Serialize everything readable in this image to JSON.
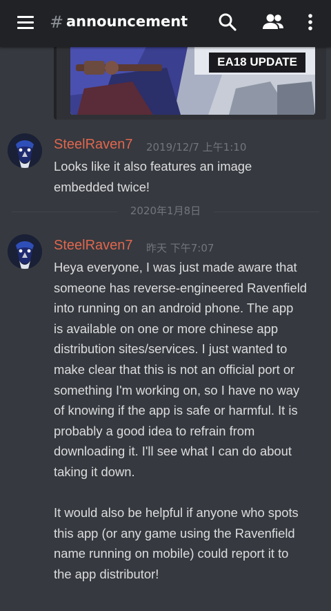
{
  "header": {
    "channel_hash": "#",
    "channel_name": "announcement",
    "icons": [
      "menu-icon",
      "search-icon",
      "members-icon",
      "more-vertical-icon"
    ]
  },
  "embed": {
    "banner_text": "EA18 UPDATE"
  },
  "messages": [
    {
      "author": "SteelRaven7",
      "timestamp": "2019/12/7 上午1:10",
      "text": "Looks like it also features an image\nembedded twice!"
    },
    {
      "author": "SteelRaven7",
      "timestamp": "昨天 下午7:07",
      "text": "Heya everyone, I was just made aware that\nsomeone has reverse-engineered Ravenfield\ninto running on an android phone. The app\nis available on one or more chinese app\ndistribution sites/services. I just wanted to\nmake clear that this is not an official port or\nsomething I'm working on, so I have no way\nof knowing if the app is safe or harmful. It is\nprobably a good idea to refrain from\ndownloading it. I'll see what I can do about\ntaking it down.\n\nIt would also be helpful if anyone who spots\nthis app (or any game using the Ravenfield\nname running on mobile) could report it to\nthe app distributor!"
    }
  ],
  "date_divider": "2020年1月8日",
  "colors": {
    "background": "#36393f",
    "topbar": "#202225",
    "author": "#e0674e",
    "timestamp": "#72767d",
    "text": "#dcddde"
  }
}
